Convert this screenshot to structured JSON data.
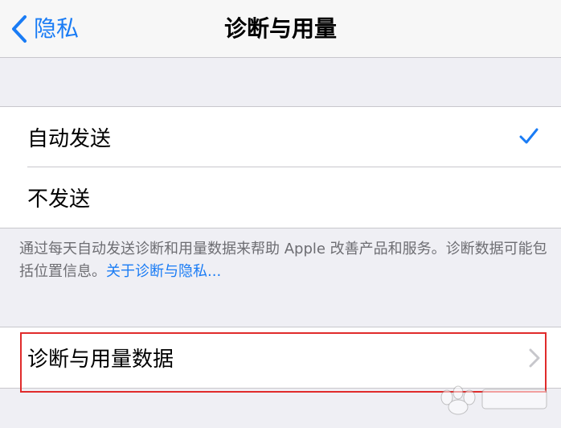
{
  "navbar": {
    "back_label": "隐私",
    "title": "诊断与用量"
  },
  "options": {
    "auto_send": "自动发送",
    "dont_send": "不发送",
    "selected": "auto_send"
  },
  "footer": {
    "text": "通过每天自动发送诊断和用量数据来帮助 Apple 改善产品和服务。诊断数据可能包括位置信息。",
    "link": "关于诊断与隐私..."
  },
  "data_row": {
    "label": "诊断与用量数据"
  },
  "colors": {
    "accent": "#1a7cf5",
    "highlight": "#e02b2b",
    "background": "#efeff4"
  },
  "icons": {
    "back": "chevron-left-icon",
    "check": "checkmark-icon",
    "disclosure": "chevron-right-icon"
  }
}
